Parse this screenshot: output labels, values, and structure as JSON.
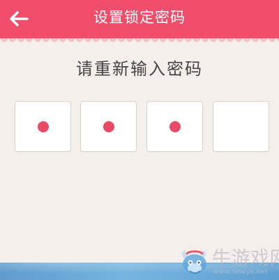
{
  "header": {
    "title": "设置锁定密码",
    "back_icon": "arrow-left-icon",
    "background_color": "#f04d6b"
  },
  "prompt": {
    "text": "请重新输入密码"
  },
  "pin": {
    "boxes": [
      {
        "filled": true
      },
      {
        "filled": true
      },
      {
        "filled": true
      },
      {
        "filled": false
      }
    ],
    "dot_color": "#e84b65"
  },
  "watermark": {
    "brand": "牛游戏网",
    "url": "www.newyx.net",
    "logo_icon": "bull-mascot-icon"
  }
}
